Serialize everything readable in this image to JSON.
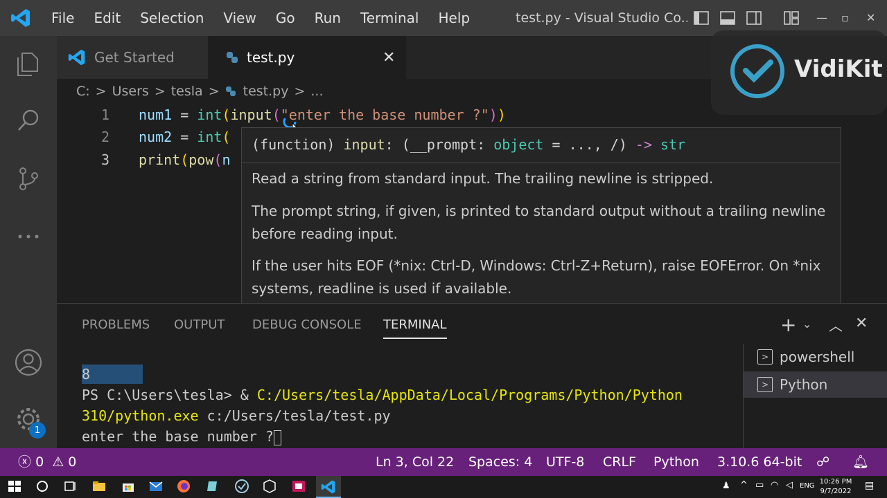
{
  "titlebar": {
    "menu": [
      "File",
      "Edit",
      "Selection",
      "View",
      "Go",
      "Run",
      "Terminal",
      "Help"
    ],
    "window_title": "test.py - Visual Studio Co..."
  },
  "tabs": {
    "get_started": "Get Started",
    "test_py": "test.py"
  },
  "breadcrumb": [
    "C:",
    ">",
    "Users",
    ">",
    "tesla",
    ">",
    "test.py",
    ">",
    "..."
  ],
  "editor": {
    "line_numbers": [
      "1",
      "2",
      "3"
    ],
    "line1": {
      "a": "num1",
      "b": " = ",
      "c": "int",
      "d": "(",
      "e": "input",
      "f": "(",
      "g": "\"enter the base number ?\"",
      "h": ")",
      "i": ")"
    },
    "line2": {
      "a": "num2",
      "b": " = ",
      "c": "int",
      "d": "("
    },
    "line3": {
      "a": "print",
      "b": "(",
      "c": "pow",
      "d": "(",
      "e": "n"
    }
  },
  "hover": {
    "sig_kind": "(function) ",
    "sig_name": "input",
    "sig_rest1": ": (__prompt: ",
    "sig_type": "object",
    "sig_rest2": " = ..., /) ",
    "sig_arrow": "->",
    "sig_ret": " str",
    "p1": "Read a string from standard input. The trailing newline is stripped.",
    "p2": "The prompt string, if given, is printed to standard output without a trailing newline before reading input.",
    "p3": "If the user hits EOF (*nix: Ctrl-D, Windows: Ctrl-Z+Return), raise EOFError. On *nix systems, readline is used if available."
  },
  "watermark": "VidiKit",
  "panel": {
    "tabs": [
      "PROBLEMS",
      "OUTPUT",
      "DEBUG CONSOLE",
      "TERMINAL"
    ],
    "terminal": {
      "line0": "8",
      "line1_prefix": "PS C:\\Users\\tesla> & ",
      "line1_path": "C:/Users/tesla/AppData/Local/Programs/Python/Python",
      "line2_path": "310/python.exe",
      "line2_rest": " c:/Users/tesla/test.py",
      "line3": "enter the base number ?"
    },
    "terminals": [
      "powershell",
      "Python"
    ]
  },
  "status": {
    "errors": "0",
    "warnings": "0",
    "position": "Ln 3, Col 22",
    "spaces": "Spaces: 4",
    "encoding": "UTF-8",
    "eol": "CRLF",
    "language": "Python",
    "interpreter": "3.10.6 64-bit"
  },
  "activity_badge": "1",
  "taskbar": {
    "lang": "ENG",
    "time": "10:26 PM",
    "date": "9/7/2022"
  },
  "colors": {
    "status_bar": "#68217a",
    "accent": "#0e70c0"
  }
}
